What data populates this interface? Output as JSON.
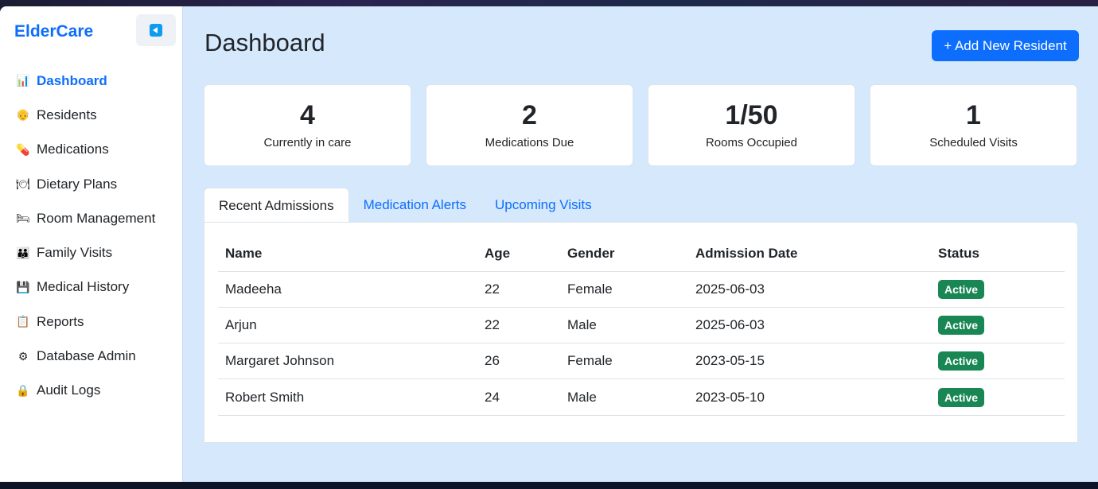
{
  "sidebar": {
    "brand": "ElderCare",
    "items": [
      {
        "label": "Dashboard",
        "icon": "📊",
        "icon_name": "chart-icon",
        "active": true
      },
      {
        "label": "Residents",
        "icon": "👴",
        "icon_name": "elder-icon"
      },
      {
        "label": "Medications",
        "icon": "💊",
        "icon_name": "pill-icon"
      },
      {
        "label": "Dietary Plans",
        "icon": "🍽",
        "icon_name": "plate-icon"
      },
      {
        "label": "Room Management",
        "icon": "🛏",
        "icon_name": "bed-icon"
      },
      {
        "label": "Family Visits",
        "icon": "👪",
        "icon_name": "family-icon"
      },
      {
        "label": "Medical History",
        "icon": "💾",
        "icon_name": "floppy-icon"
      },
      {
        "label": "Reports",
        "icon": "📋",
        "icon_name": "clipboard-icon"
      },
      {
        "label": "Database Admin",
        "icon": "⚙",
        "icon_name": "gear-icon"
      },
      {
        "label": "Audit Logs",
        "icon": "🔒",
        "icon_name": "lock-icon"
      }
    ]
  },
  "header": {
    "title": "Dashboard",
    "add_button": "+ Add New Resident"
  },
  "stats": [
    {
      "value": "4",
      "label": "Currently in care"
    },
    {
      "value": "2",
      "label": "Medications Due"
    },
    {
      "value": "1/50",
      "label": "Rooms Occupied"
    },
    {
      "value": "1",
      "label": "Scheduled Visits"
    }
  ],
  "tabs": [
    {
      "label": "Recent Admissions",
      "active": true
    },
    {
      "label": "Medication Alerts"
    },
    {
      "label": "Upcoming Visits"
    }
  ],
  "table": {
    "columns": [
      "Name",
      "Age",
      "Gender",
      "Admission Date",
      "Status"
    ],
    "rows": [
      {
        "name": "Madeeha",
        "age": "22",
        "gender": "Female",
        "date": "2025-06-03",
        "status": "Active"
      },
      {
        "name": "Arjun",
        "age": "22",
        "gender": "Male",
        "date": "2025-06-03",
        "status": "Active"
      },
      {
        "name": "Margaret Johnson",
        "age": "26",
        "gender": "Female",
        "date": "2023-05-15",
        "status": "Active"
      },
      {
        "name": "Robert Smith",
        "age": "24",
        "gender": "Male",
        "date": "2023-05-10",
        "status": "Active"
      }
    ]
  },
  "colors": {
    "accent": "#0d6efd",
    "status_active": "#198754",
    "main_bg": "#d5e8fc"
  }
}
